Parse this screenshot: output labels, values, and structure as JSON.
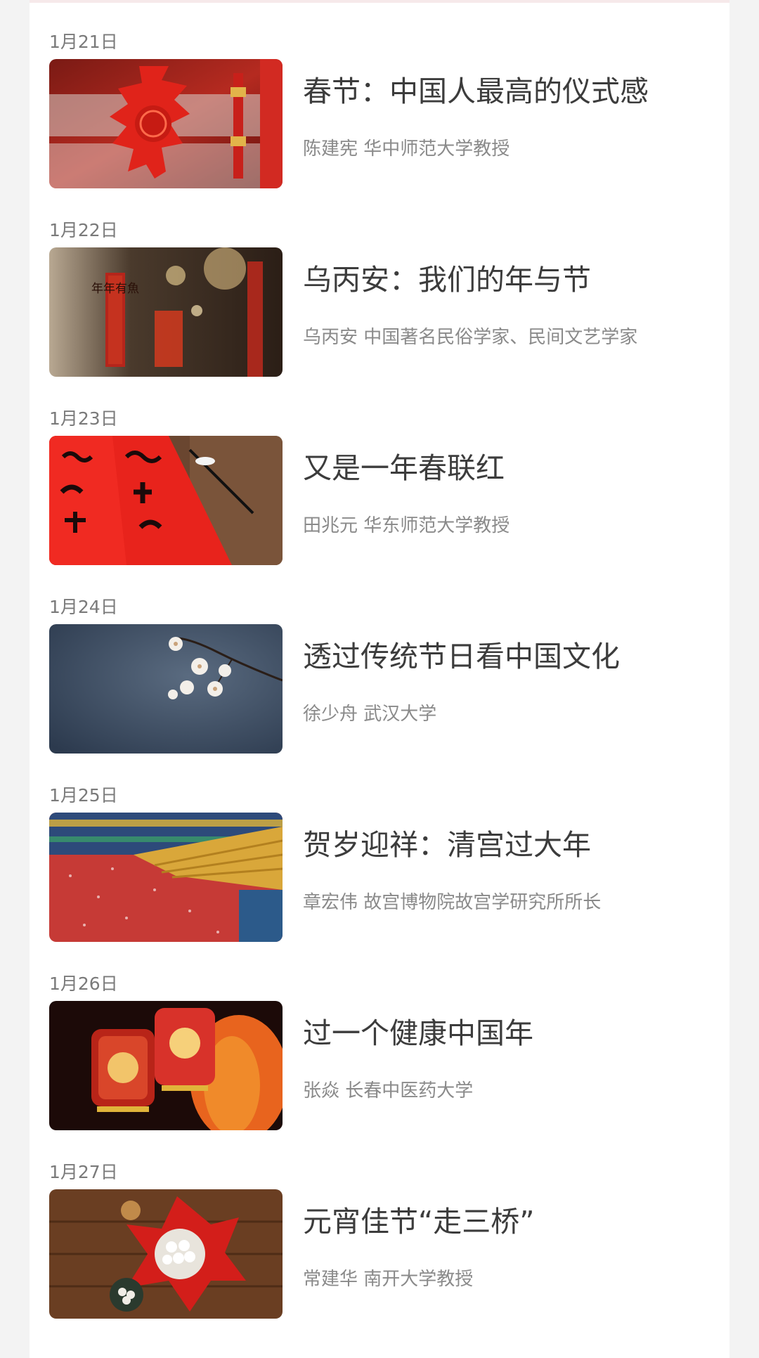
{
  "colors": {
    "background": "#f3f3f3",
    "card": "#ffffff",
    "title": "#3c3c3c",
    "meta": "#8a8a8a",
    "date": "#7a7a7a"
  },
  "items": [
    {
      "date": "1月21日",
      "title": "春节：中国人最高的仪式感",
      "author": "陈建宪 华中师范大学教授",
      "thumb_icon": "spring-festival-decoration-image"
    },
    {
      "date": "1月22日",
      "title": "乌丙安：我们的年与节",
      "author": "乌丙安 中国著名民俗学家、民间文艺学家",
      "thumb_icon": "lantern-couplet-image",
      "thumb_text": "年年有魚"
    },
    {
      "date": "1月23日",
      "title": "又是一年春联红",
      "author": "田兆元 华东师范大学教授",
      "thumb_icon": "couplet-calligraphy-image"
    },
    {
      "date": "1月24日",
      "title": "透过传统节日看中国文化",
      "author": "徐少舟 武汉大学",
      "thumb_icon": "plum-blossom-image"
    },
    {
      "date": "1月25日",
      "title": "贺岁迎祥：清宫过大年",
      "author": "章宏伟 故宫博物院故宫学研究所所长",
      "thumb_icon": "palace-roof-snow-image"
    },
    {
      "date": "1月26日",
      "title": "过一个健康中国年",
      "author": "张焱 长春中医药大学",
      "thumb_icon": "red-lanterns-image"
    },
    {
      "date": "1月27日",
      "title": "元宵佳节“走三桥”",
      "author": "常建华 南开大学教授",
      "thumb_icon": "tangyuan-knot-image"
    }
  ]
}
